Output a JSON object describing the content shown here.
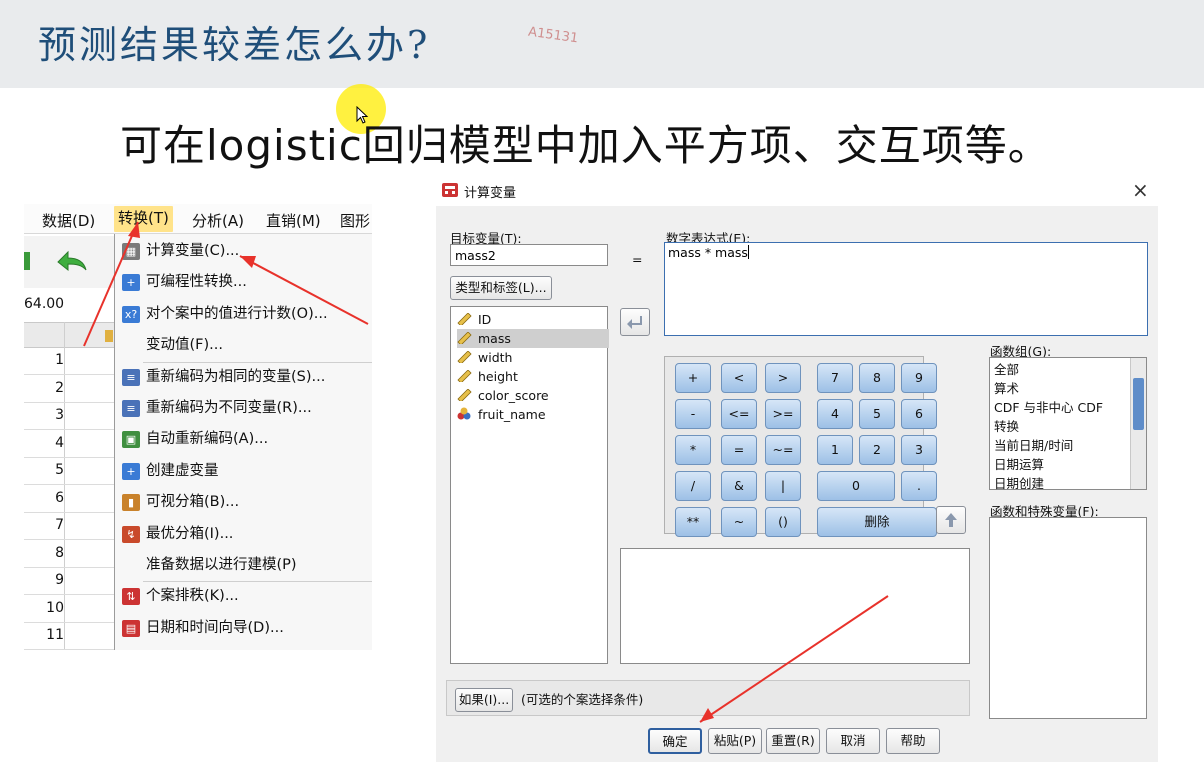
{
  "slide": {
    "title": "预测结果较差怎么办?",
    "watermark": "A15131",
    "body": "可在logistic回归模型中加入平方项、交互项等。"
  },
  "spss": {
    "menubar": [
      "数据(D)",
      "转换(T)",
      "分析(A)",
      "直销(M)",
      "图形"
    ],
    "cell_ref": "64.00",
    "rows": [
      "1",
      "2",
      "3",
      "4",
      "5",
      "6",
      "7",
      "8",
      "9",
      "10",
      "11"
    ],
    "menu_items": [
      {
        "label": "计算变量(C)...",
        "icon": "calculator-icon"
      },
      {
        "label": "可编程性转换...",
        "icon": "plus-icon"
      },
      {
        "label": "对个案中的值进行计数(O)...",
        "icon": "count-icon"
      },
      {
        "label": "变动值(F)...",
        "icon": ""
      },
      {
        "label": "重新编码为相同的变量(S)...",
        "icon": "recode-icon"
      },
      {
        "label": "重新编码为不同变量(R)...",
        "icon": "recode-icon"
      },
      {
        "label": "自动重新编码(A)...",
        "icon": "auto-recode-icon"
      },
      {
        "label": "创建虚变量",
        "icon": "plus-icon"
      },
      {
        "label": "可视分箱(B)...",
        "icon": "binning-icon"
      },
      {
        "label": "最优分箱(I)...",
        "icon": "optimal-binning-icon"
      },
      {
        "label": "准备数据以进行建模(P)",
        "icon": ""
      },
      {
        "label": "个案排秩(K)...",
        "icon": "rank-icon"
      },
      {
        "label": "日期和时间向导(D)...",
        "icon": "calendar-icon"
      }
    ]
  },
  "dialog": {
    "title": "计算变量",
    "close": "×",
    "target_label": "目标变量(T):",
    "target_value": "mass2",
    "equals": "=",
    "expr_label": "数字表达式(E):",
    "expr_value": "mass * mass",
    "type_label_button": "类型和标签(L)...",
    "variables": [
      "ID",
      "mass",
      "width",
      "height",
      "color_score",
      "fruit_name"
    ],
    "selected_variable": "mass",
    "keypad": {
      "ops": [
        "+",
        "-",
        "*",
        "/",
        "**",
        "<",
        "<=",
        "=",
        "&",
        "~",
        ">",
        ">=",
        "~=",
        "|",
        "()"
      ],
      "digits": [
        "7",
        "8",
        "9",
        "4",
        "5",
        "6",
        "1",
        "2",
        "3",
        "0",
        "."
      ],
      "delete": "删除"
    },
    "function_group_label": "函数组(G):",
    "function_groups": [
      "全部",
      "算术",
      "CDF 与非中心 CDF",
      "转换",
      "当前日期/时间",
      "日期运算",
      "日期创建"
    ],
    "functions_label": "函数和特殊变量(F):",
    "if_button": "如果(I)...",
    "if_text": "(可选的个案选择条件)",
    "buttons": {
      "ok": "确定",
      "paste": "粘贴(P)",
      "reset": "重置(R)",
      "cancel": "取消",
      "help": "帮助"
    }
  },
  "colors": {
    "title": "#1f4e79",
    "highlight": "#ffe38a",
    "annotation": "#e8322b",
    "key": "#9dc0e6"
  }
}
